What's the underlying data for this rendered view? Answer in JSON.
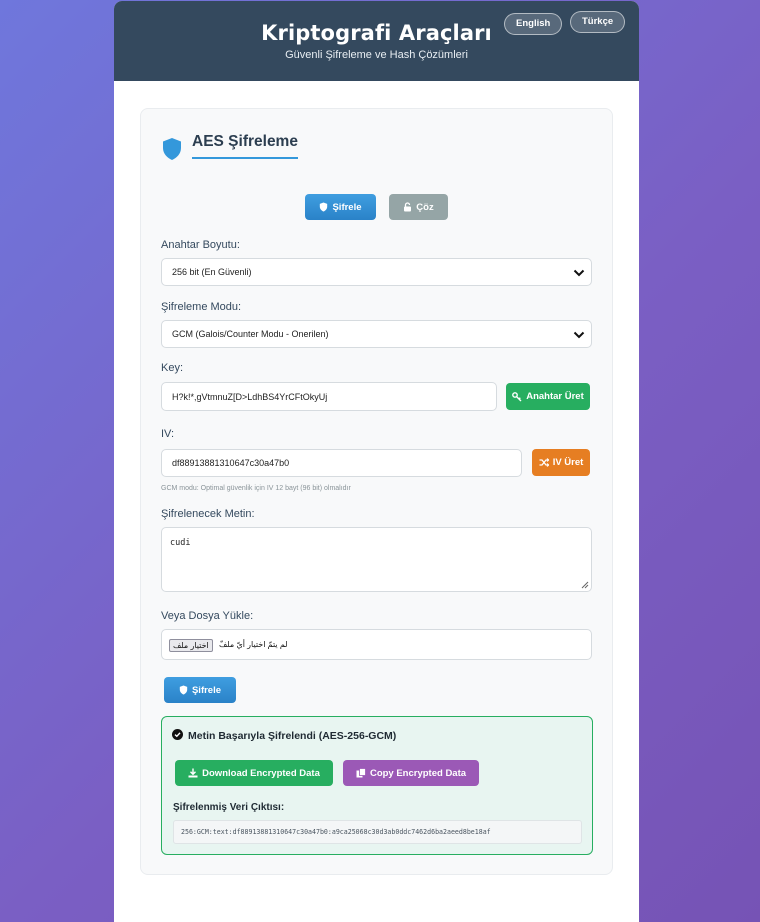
{
  "header": {
    "title": "Kriptografi Araçları",
    "subtitle": "Güvenli Şifreleme ve Hash Çözümleri",
    "lang_en": "English",
    "lang_tr": "Türkçe"
  },
  "section": {
    "title": "AES Şifreleme",
    "tab_encrypt": "Şifrele",
    "tab_decrypt": "Çöz"
  },
  "key_size": {
    "label": "Anahtar Boyutu:",
    "value": "256 bit (En Güvenli)"
  },
  "mode": {
    "label": "Şifreleme Modu:",
    "value": "GCM (Galois/Counter Modu - Onerilen)"
  },
  "key": {
    "label": "Key:",
    "value": "H?k!*,gVtmnuZ[D>LdhBS4YrCFtOkyUj",
    "generate_label": "Anahtar Üret"
  },
  "iv": {
    "label": "IV:",
    "value": "df88913881310647c30a47b0",
    "generate_label": "IV Üret",
    "hint": "GCM modu: Optimal güvenlik için IV 12 bayt (96 bit) olmalıdır"
  },
  "plaintext": {
    "label": "Şifrelenecek Metin:",
    "value": "cudi"
  },
  "file": {
    "label": "Veya Dosya Yükle:",
    "button": "اختيار ملف",
    "status": "لم يتمّ اختيار أيّ ملفّ"
  },
  "encrypt_button": "Şifrele",
  "result": {
    "title": "Metin Başarıyla Şifrelendi (AES-256-GCM)",
    "download_label": "Download Encrypted Data",
    "copy_label": "Copy Encrypted Data",
    "output_label": "Şifrelenmiş Veri Çıktısı:",
    "output_value": "256:GCM:text:df88913881310647c30a47b0:a9ca25068c30d3ab0ddc7462d6ba2aeed8be18af"
  },
  "colors": {
    "header_bg": "#34495e",
    "accent_blue": "#3498db",
    "green": "#27ae60",
    "orange": "#e67e22",
    "purple": "#9b59b6",
    "gray": "#95a5a6"
  }
}
